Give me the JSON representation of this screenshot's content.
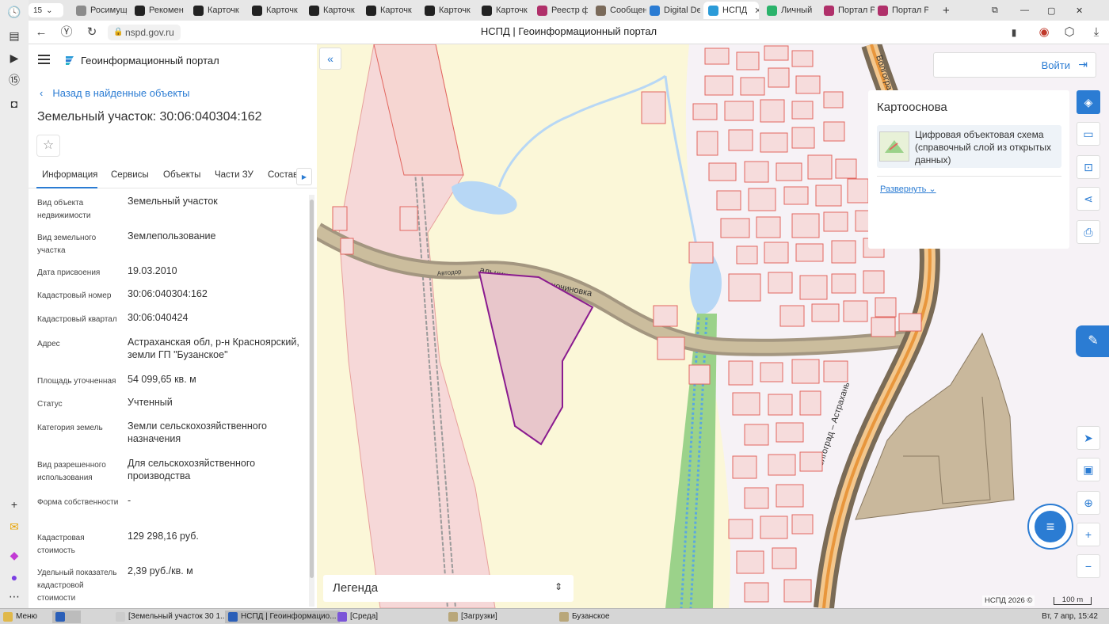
{
  "browser": {
    "tab_counter": "15",
    "tabs": [
      {
        "label": "Росимущ",
        "color": "#8b8b8b"
      },
      {
        "label": "Рекомен",
        "color": "#222222"
      },
      {
        "label": "Карточк",
        "color": "#222222"
      },
      {
        "label": "Карточк",
        "color": "#222222"
      },
      {
        "label": "Карточк",
        "color": "#222222"
      },
      {
        "label": "Карточк",
        "color": "#222222"
      },
      {
        "label": "Карточк",
        "color": "#222222"
      },
      {
        "label": "Карточк",
        "color": "#222222"
      },
      {
        "label": "Реестр ф",
        "color": "#b0306a"
      },
      {
        "label": "Сообщен",
        "color": "#7a6a5a"
      },
      {
        "label": "Digital De",
        "color": "#2b7cd3"
      },
      {
        "label": "НСПД",
        "color": "#2b9bd8"
      },
      {
        "label": "Личный",
        "color": "#2bb36b"
      },
      {
        "label": "Портал Р",
        "color": "#b0306a"
      },
      {
        "label": "Портал Р",
        "color": "#b0306a"
      }
    ],
    "url": "nspd.gov.ru",
    "page_title": "НСПД | Геоинформационный портал"
  },
  "panel": {
    "portal_title": "Геоинформационный портал",
    "back_label": "Назад в найденные объекты",
    "object_title": "Земельный участок: 30:06:040304:162",
    "tabs": [
      "Информация",
      "Сервисы",
      "Объекты",
      "Части ЗУ",
      "Состав"
    ],
    "props": [
      {
        "label": "Вид объекта недвижимости",
        "value": "Земельный участок"
      },
      {
        "label": "Вид земельного участка",
        "value": "Землепользование"
      },
      {
        "label": "Дата присвоения",
        "value": "19.03.2010"
      },
      {
        "label": "Кадастровый номер",
        "value": "30:06:040304:162"
      },
      {
        "label": "Кадастровый квартал",
        "value": "30:06:040424"
      },
      {
        "label": "Адрес",
        "value": "Астраханская обл, р-н Красноярский, земли ГП \"Бузанское\""
      },
      {
        "label": "Площадь уточненная",
        "value": "54 099,65 кв. м"
      },
      {
        "label": "Статус",
        "value": "Учтенный"
      },
      {
        "label": "Категория земель",
        "value": "Земли сельскохозяйственного назначения"
      },
      {
        "label": "Вид разрешенного использования",
        "value": "Для сельскохозяйственного производства"
      },
      {
        "label": "Форма собственности",
        "value": "-"
      },
      {
        "label": "Кадастровая стоимость",
        "value": "129 298,16 руб."
      },
      {
        "label": "Удельный показатель кадастровой стоимости",
        "value": "2,39 руб./кв. м"
      }
    ]
  },
  "map": {
    "login_label": "Войти",
    "basemap_title": "Картооснова",
    "basemap_layer": "Цифровая объектовая схема (справочный слой из открытых данных)",
    "expand_label": "Развернуть",
    "legend_label": "Легенда",
    "attribution": "НСПД 2026 ©",
    "scale_label": "100 m",
    "road_label_1": "Автодор",
    "road_label_2": "альниковый – Разночиновка",
    "road_label_3": "Волгоград – Астрахань",
    "road_label_4": "Волгоград",
    "colors": {
      "accent": "#2b7cd3",
      "parcel_selected": "#8a1b8f",
      "parcel": "#e2665f"
    }
  },
  "taskbar": {
    "menu_label": "Меню",
    "items": [
      "[Земельный участок 30 1...",
      "НСПД | Геоинформацио...",
      "[Среда]",
      "[Загрузки]",
      "Бузанское"
    ],
    "clock": "Вт, 7 апр, 15:42"
  }
}
